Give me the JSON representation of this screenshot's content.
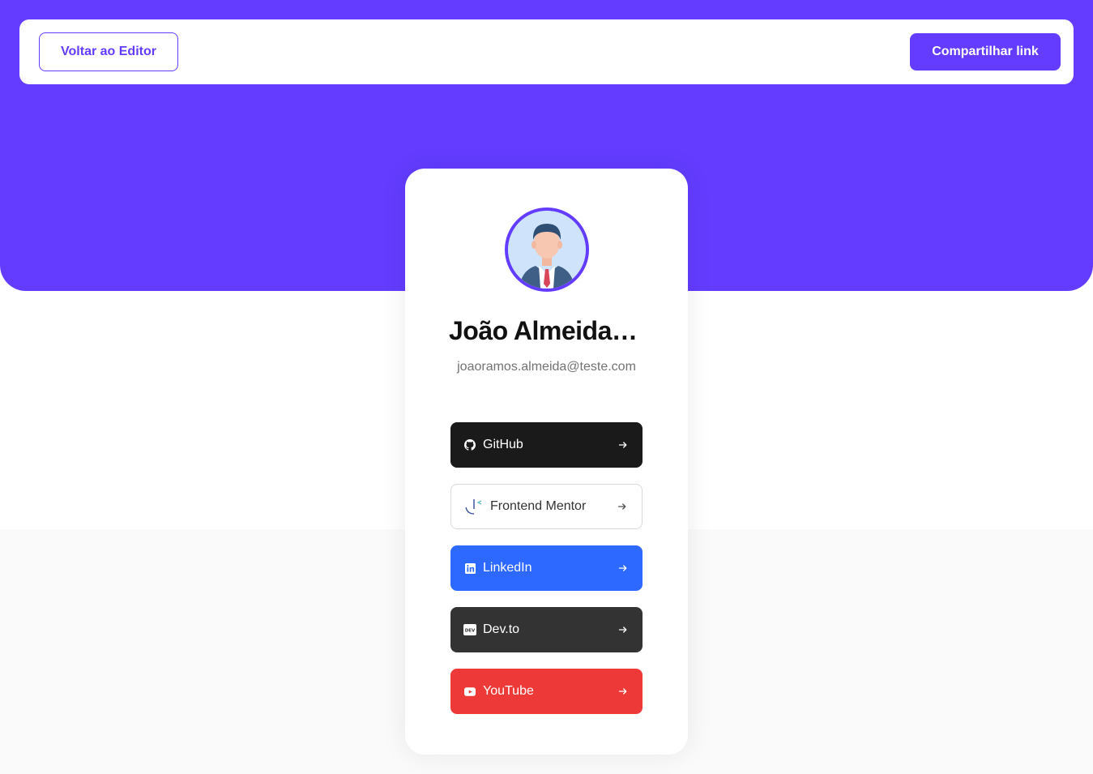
{
  "header": {
    "back_label": "Voltar ao Editor",
    "share_label": "Compartilhar link"
  },
  "profile": {
    "name": "João Almeida Ramos",
    "email": "joaoramos.almeida@teste.com"
  },
  "links": [
    {
      "platform": "GitHub",
      "icon": "github-icon",
      "color": "#1a1a1a",
      "text_color": "#ffffff"
    },
    {
      "platform": "Frontend Mentor",
      "icon": "frontend-mentor-icon",
      "color": "#ffffff",
      "text_color": "#333333"
    },
    {
      "platform": "LinkedIn",
      "icon": "linkedin-icon",
      "color": "#2d68ff",
      "text_color": "#ffffff"
    },
    {
      "platform": "Dev.to",
      "icon": "devto-icon",
      "color": "#333333",
      "text_color": "#ffffff"
    },
    {
      "platform": "YouTube",
      "icon": "youtube-icon",
      "color": "#ee3939",
      "text_color": "#ffffff"
    }
  ],
  "colors": {
    "accent": "#633cff",
    "background": "#fafafa"
  }
}
